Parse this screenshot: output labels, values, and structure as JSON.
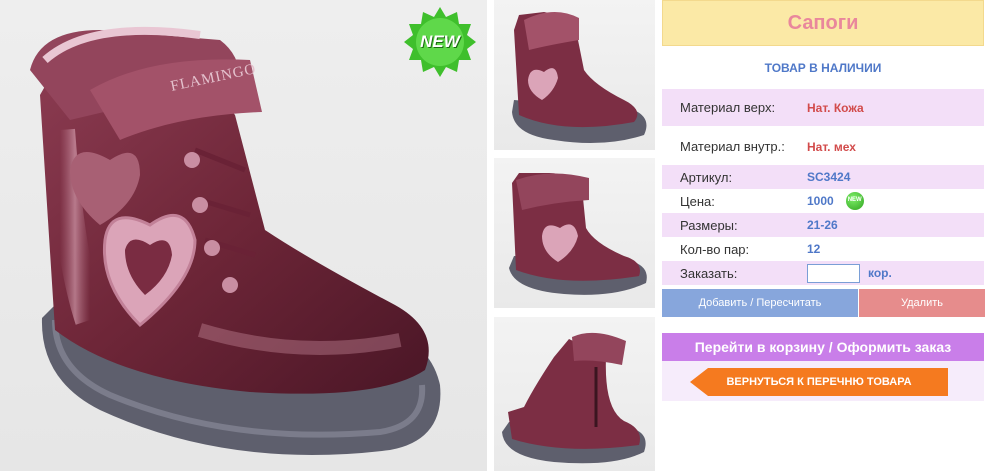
{
  "product": {
    "title": "Сапоги",
    "availability": "ТОВАР В НАЛИЧИИ",
    "badge": "NEW",
    "brand_print": "FLAMINGO"
  },
  "specs": [
    {
      "label": "Материал верх:",
      "value": "Нат. Кожа"
    },
    {
      "label": "Материал внутр.:",
      "value": "Нат. мех"
    },
    {
      "label": "Артикул:",
      "value": "SC3424"
    },
    {
      "label": "Цена:",
      "value": "1000"
    },
    {
      "label": "Размеры:",
      "value": "21-26"
    },
    {
      "label": "Кол-во пар:",
      "value": "12"
    }
  ],
  "order": {
    "label": "Заказать:",
    "value": "",
    "unit": "кор."
  },
  "price_badge": "NEW",
  "buttons": {
    "recalc": "Добавить / Пересчитать",
    "delete": "Удалить",
    "cart": "Перейти в корзину / Оформить заказ",
    "back": "ВЕРНУТЬСЯ К ПЕРЕЧНЮ ТОВАРА"
  },
  "colors": {
    "title_bg": "#fbe9a6",
    "accent_blue": "#4f78c8",
    "accent_red": "#d24b4b",
    "cart_purple": "#c97ee9",
    "back_orange": "#f57a1f"
  }
}
